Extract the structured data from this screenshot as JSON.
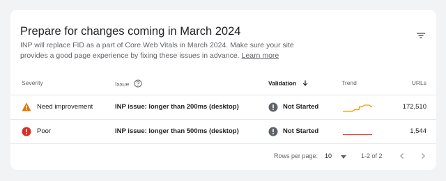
{
  "card": {
    "title": "Prepare for changes coming in March 2024",
    "description": "INP will replace FID as a part of Core Web Vitals in March 2024. Make sure your site provides a good page experience by fixing these issues in advance.",
    "learn_more": "Learn more",
    "filter_icon": "filter-icon"
  },
  "columns": {
    "severity": "Severity",
    "issue": "Issue",
    "validation": "Validation",
    "trend": "Trend",
    "urls": "URLs"
  },
  "rows": [
    {
      "severity": "Need improvement",
      "severity_icon": "warning-icon",
      "severity_color": "#e37400",
      "issue": "INP issue: longer than 200ms (desktop)",
      "validation": "Not Started",
      "validation_icon": "info-icon",
      "trend_color": "#f29900",
      "urls": "172,510"
    },
    {
      "severity": "Poor",
      "severity_icon": "error-icon",
      "severity_color": "#d93025",
      "issue": "INP issue: longer than 500ms (desktop)",
      "validation": "Not Started",
      "validation_icon": "info-icon",
      "trend_color": "#d93025",
      "urls": "1,544"
    }
  ],
  "pagination": {
    "rows_per_page_label": "Rows per page:",
    "rows_per_page_value": "10",
    "range": "1-2 of 2"
  }
}
